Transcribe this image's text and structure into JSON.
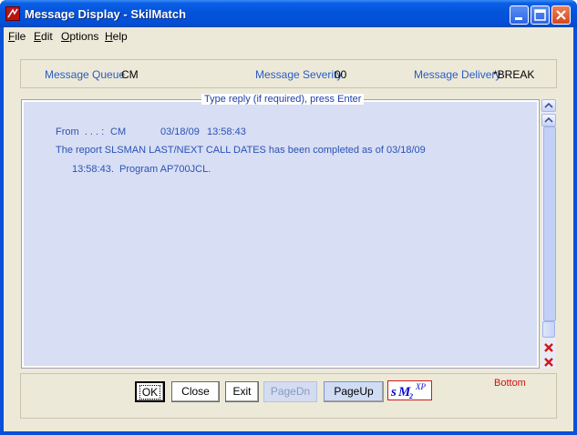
{
  "window": {
    "title": "Message Display - SkilMatch"
  },
  "menu": [
    "File",
    "Edit",
    "Options",
    "Help"
  ],
  "header": {
    "queue_label": "Message Queue",
    "queue_value": "CM",
    "severity_label": "Message Severity",
    "severity_value": "00",
    "delivery_label": "Message Delivery",
    "delivery_value": "*BREAK"
  },
  "message": {
    "caption": "Type reply (if required), press Enter",
    "from_label": "From  . . . :",
    "from_value": "CM",
    "date": "03/18/09",
    "time": "13:58:43",
    "line1": "The report SLSMAN LAST/NEXT CALL DATES has been completed as of 03/18/09",
    "line2": "13:58:43.  Program AP700JCL."
  },
  "buttons": {
    "ok": "OK",
    "close": "Close",
    "exit": "Exit",
    "page_down": "PageDn",
    "page_up": "PageUp"
  },
  "status": "Bottom",
  "logo": {
    "text": "sM2XP",
    "color": "#0a0ad0",
    "border_color": "#d01818"
  },
  "colors": {
    "title_bar": "#0352d9",
    "label_blue": "#2a5bc6",
    "message_bg": "#d8def3",
    "status_red": "#d01010"
  },
  "icons": [
    "app-icon",
    "minimize-icon",
    "maximize-icon",
    "close-icon",
    "scroll-up-icon",
    "scroll-top-icon",
    "delete-x-icon"
  ]
}
